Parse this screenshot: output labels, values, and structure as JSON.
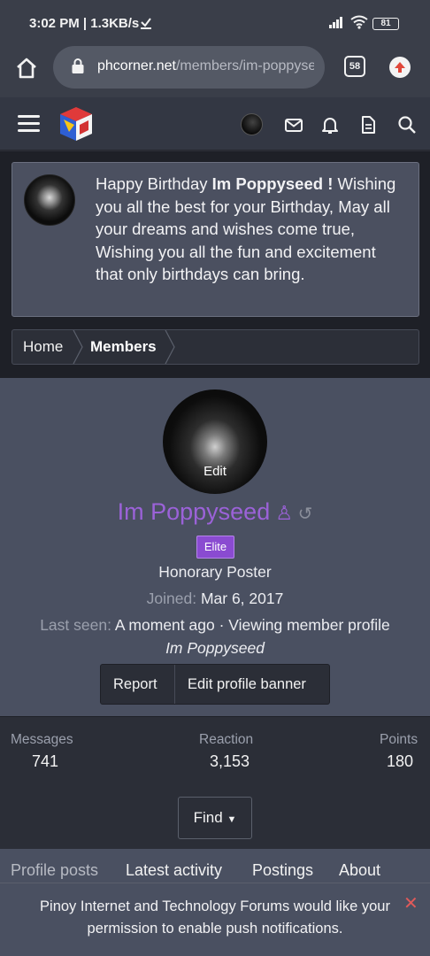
{
  "status_bar": {
    "time": "3:02 PM | 1.3KB/s",
    "battery": "81"
  },
  "browser": {
    "url_domain": "phcorner.net",
    "url_path": "/members/im-poppyseed",
    "tab_count": "58"
  },
  "notice": {
    "greeting": "Happy Birthday ",
    "name": "Im Poppyseed !",
    "message": "Wishing you all the best for your Birthday, May all your dreams and wishes come true, Wishing you all the fun and excitement that only birthdays can bring."
  },
  "breadcrumb": {
    "home": "Home",
    "members": "Members"
  },
  "profile": {
    "avatar_edit": "Edit",
    "name": "Im Poppyseed",
    "badge": "Elite",
    "title": "Honorary Poster",
    "joined_label": "Joined:",
    "joined_value": "Mar 6, 2017",
    "last_seen_label": "Last seen:",
    "last_seen_value": "A moment ago · Viewing member profile",
    "last_seen_target": "Im Poppyseed",
    "report_label": "Report",
    "edit_banner_label": "Edit profile banner"
  },
  "stats": {
    "messages_label": "Messages",
    "messages_value": "741",
    "reaction_label": "Reaction",
    "reaction_value": "3,153",
    "points_label": "Points",
    "points_value": "180",
    "find_label": "Find"
  },
  "tabs": [
    "Profile posts",
    "Latest activity",
    "Postings",
    "About"
  ],
  "push_prompt": {
    "message": "Pinoy Internet and Technology Forums would like your permission to enable push notifications.",
    "close": "✕"
  },
  "colors": {
    "accent_purple": "#9b62d8",
    "elite_badge": "#8a4bd1",
    "close_red": "#e05a5a"
  }
}
